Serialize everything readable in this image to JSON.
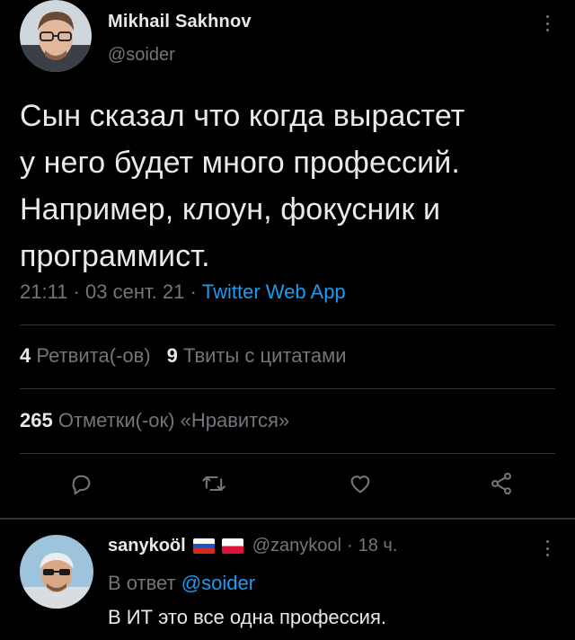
{
  "tweet": {
    "author_name": "Mikhail Sakhnov",
    "author_handle": "@soider",
    "text_lines": [
      "Сын сказал что когда вырастет",
      "у него будет много профессий.",
      "Например, клоун, фокусник и",
      "программист."
    ],
    "time": "21:11",
    "dot": "·",
    "date": "03 сент. 21",
    "source": "Twitter Web App",
    "retweets_count": "4",
    "retweets_label": "Ретвита(-ов)",
    "quotes_count": "9",
    "quotes_label": "Твиты с цитатами",
    "likes_count": "265",
    "likes_label": "Отметки(-ок) «Нравится»"
  },
  "actions": [
    "reply-icon",
    "retweet-icon",
    "like-icon",
    "share-icon"
  ],
  "reply": {
    "author_name": "sanykoöl",
    "author_handle": "@zanykool",
    "time_ago": "18 ч.",
    "dot": "·",
    "reply_to_prefix": "В ответ",
    "reply_to_handle": "@soider",
    "text": "В ИТ это все одна профессия."
  },
  "colors": {
    "background": "#000000",
    "primary_text": "#e7e9ea",
    "secondary_text": "#71767b",
    "accent": "#1d9bf0",
    "divider": "#2f3336"
  }
}
